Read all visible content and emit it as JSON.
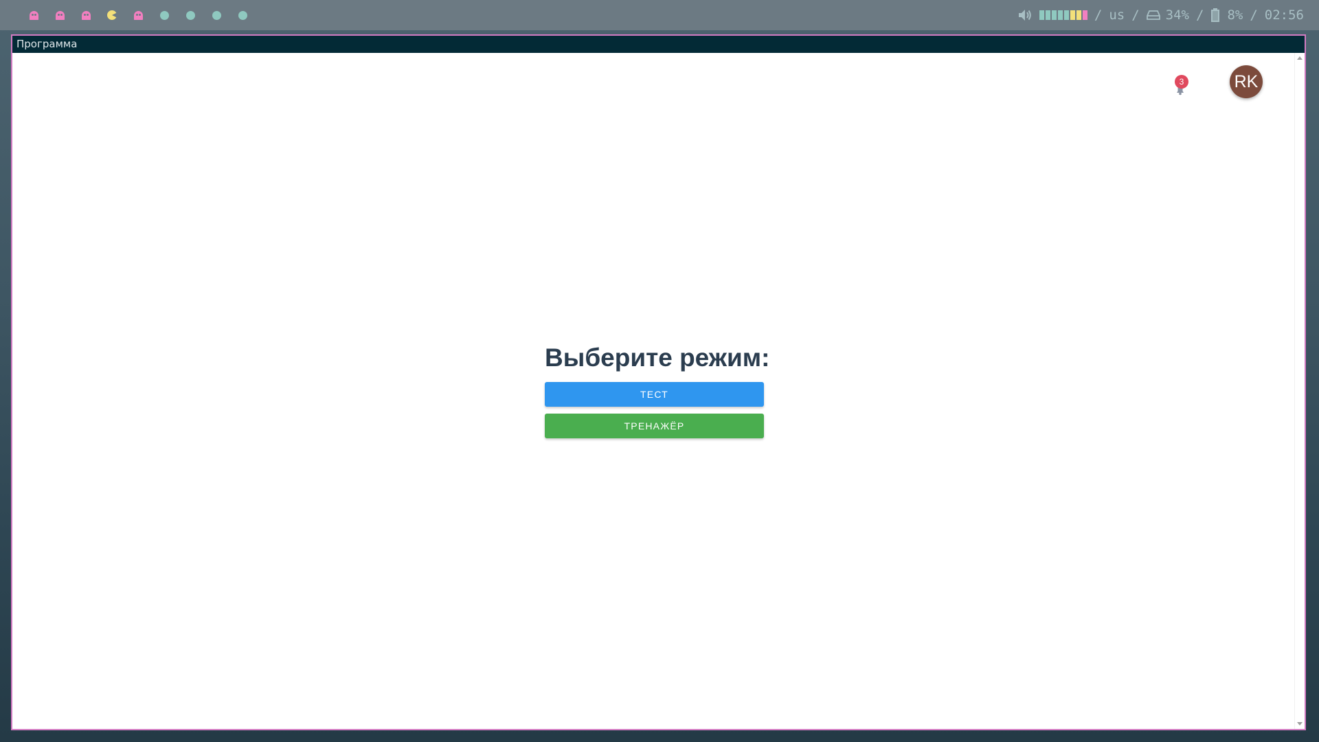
{
  "topbar": {
    "workspaces": [
      {
        "icon": "ghost-icon",
        "color": "#f27fc0"
      },
      {
        "icon": "ghost-icon",
        "color": "#f27fc0"
      },
      {
        "icon": "ghost-icon",
        "color": "#f27fc0"
      },
      {
        "icon": "pacman-icon",
        "color": "#f3e07a",
        "active": true
      },
      {
        "icon": "ghost-icon",
        "color": "#f27fc0"
      },
      {
        "icon": "dot-icon",
        "color": "#8fc9c0"
      },
      {
        "icon": "dot-icon",
        "color": "#8fc9c0"
      },
      {
        "icon": "dot-icon",
        "color": "#8fc9c0"
      },
      {
        "icon": "dot-icon",
        "color": "#8fc9c0"
      }
    ],
    "status": {
      "volume_icon": "speaker-icon",
      "volume_level": 8,
      "volume_segments": [
        "#8fc9c0",
        "#8fc9c0",
        "#8fc9c0",
        "#8fc9c0",
        "#8fc9c0",
        "#f3e07a",
        "#f3e07a",
        "#f27fc0"
      ],
      "separator": "/",
      "keyboard_layout": "us",
      "disk_icon": "disk-icon",
      "disk_usage": "34%",
      "battery_icon": "battery-icon",
      "battery": "8%",
      "clock": "02:56"
    }
  },
  "window": {
    "title": "Программа",
    "accent_border": "#d47bc3",
    "titlebar_color": "#032a36"
  },
  "header": {
    "notifications_icon": "bell-icon",
    "notifications_count": "3",
    "avatar_initials": "RK",
    "avatar_color": "#7c4b3c"
  },
  "main": {
    "heading": "Выберите режим:",
    "buttons": {
      "test": "Тест",
      "trainer": "Тренажёр"
    },
    "colors": {
      "test": "#2f96ef",
      "trainer": "#4aae4f"
    }
  }
}
